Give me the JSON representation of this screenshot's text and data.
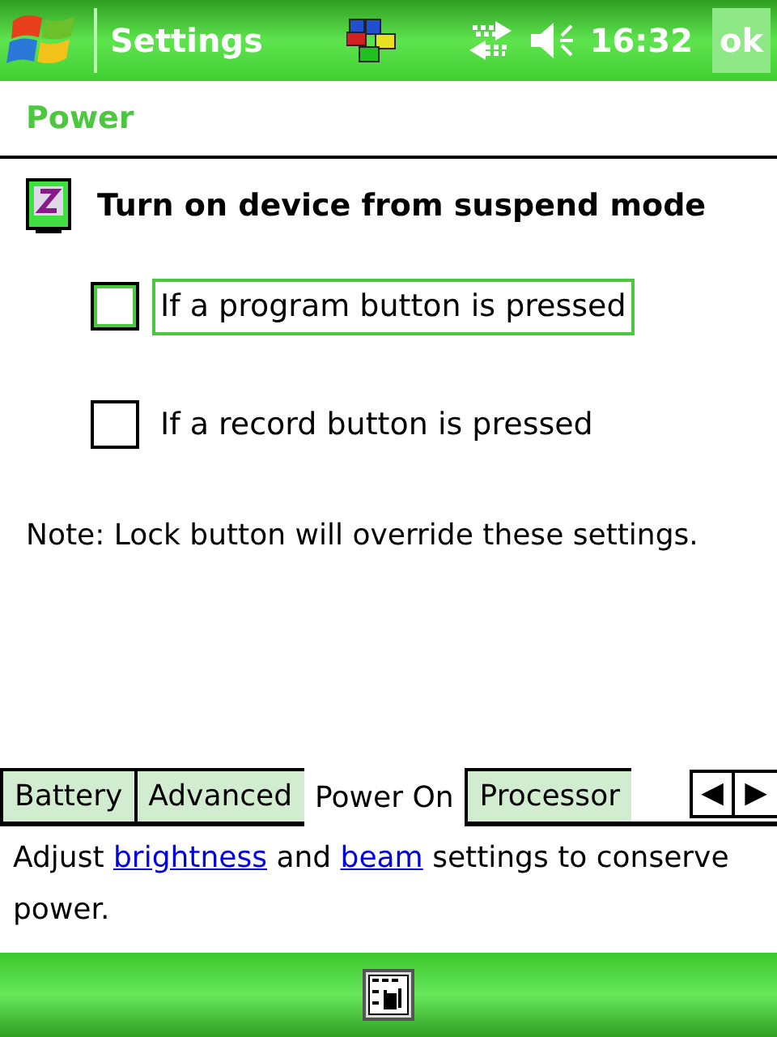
{
  "title_bar": {
    "title": "Settings",
    "time": "16:32",
    "ok": "ok"
  },
  "header": {
    "title": "Power"
  },
  "section": {
    "title": "Turn on device from suspend mode"
  },
  "options": [
    {
      "label": "If a program button is pressed",
      "checked": false,
      "focused": true
    },
    {
      "label": "If a record button is pressed",
      "checked": false,
      "focused": false
    }
  ],
  "note": "Note: Lock button will override these settings.",
  "tabs": [
    {
      "label": "Battery",
      "selected": false
    },
    {
      "label": "Advanced",
      "selected": false
    },
    {
      "label": "Power On",
      "selected": true
    },
    {
      "label": "Processor",
      "selected": false
    }
  ],
  "tab_scroll": {
    "left": "◀",
    "right": "▶"
  },
  "help": [
    {
      "kind": "text",
      "text": "Adjust "
    },
    {
      "kind": "link",
      "text": "brightness"
    },
    {
      "kind": "text",
      "text": " and "
    },
    {
      "kind": "link",
      "text": "beam"
    },
    {
      "kind": "text",
      "text": " settings to conserve power."
    }
  ]
}
